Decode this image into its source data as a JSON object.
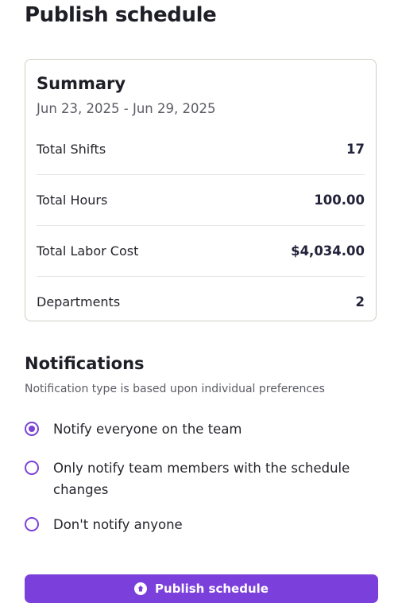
{
  "page": {
    "title": "Publish schedule"
  },
  "summary": {
    "title": "Summary",
    "date_range": "Jun 23, 2025 - Jun 29, 2025",
    "stats": [
      {
        "label": "Total Shifts",
        "value": "17"
      },
      {
        "label": "Total Hours",
        "value": "100.00"
      },
      {
        "label": "Total Labor Cost",
        "value": "$4,034.00"
      },
      {
        "label": "Departments",
        "value": "2"
      }
    ]
  },
  "notifications": {
    "title": "Notifications",
    "subtitle": "Notification type is based upon individual preferences",
    "options": [
      {
        "label": "Notify everyone on the team",
        "selected": true
      },
      {
        "label": "Only notify team members with the schedule changes",
        "selected": false
      },
      {
        "label": "Don't notify anyone",
        "selected": false
      }
    ]
  },
  "actions": {
    "publish_label": "Publish schedule",
    "publish_icon": "arrow-up-circle-icon"
  },
  "colors": {
    "accent": "#7b3fdb",
    "text": "#1e1e26",
    "muted": "#5c5c66",
    "border": "#cfcfc4"
  }
}
